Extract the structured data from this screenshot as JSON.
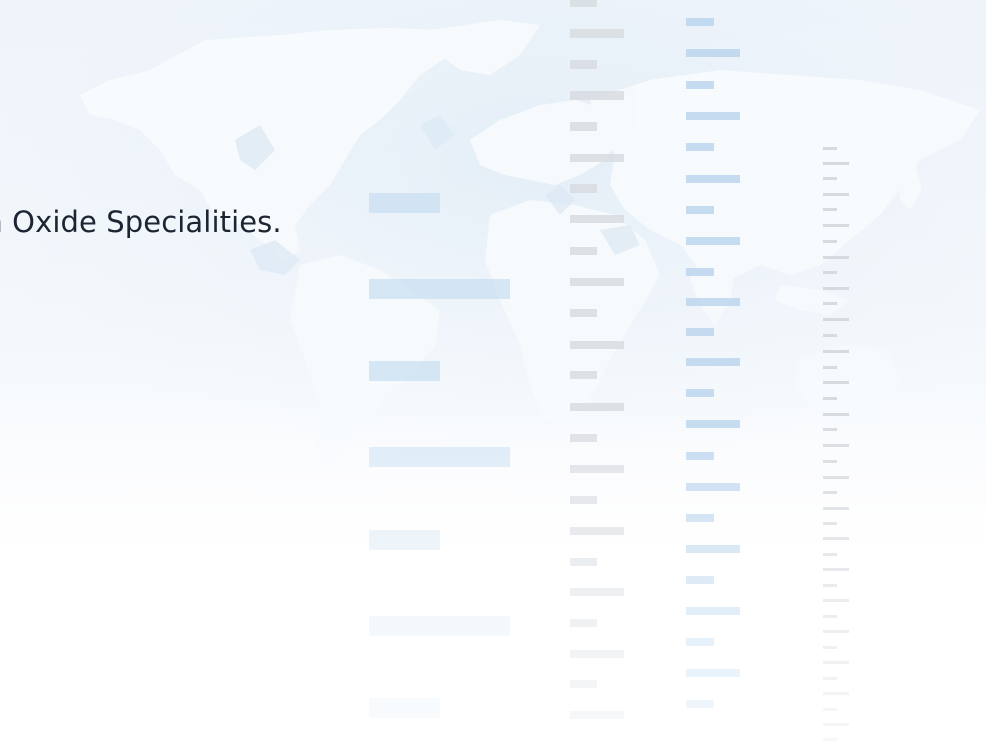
{
  "hero": {
    "headline": "um Oxide Specialities."
  },
  "background": {
    "illustration": "world-map-icon",
    "decoration": "data-bars-pattern",
    "colors": {
      "sky": "#eef4fa",
      "map_land": "#f7fafd",
      "bar_blue": "#c9dff2",
      "bar_gray": "#e3e6ea"
    }
  }
}
